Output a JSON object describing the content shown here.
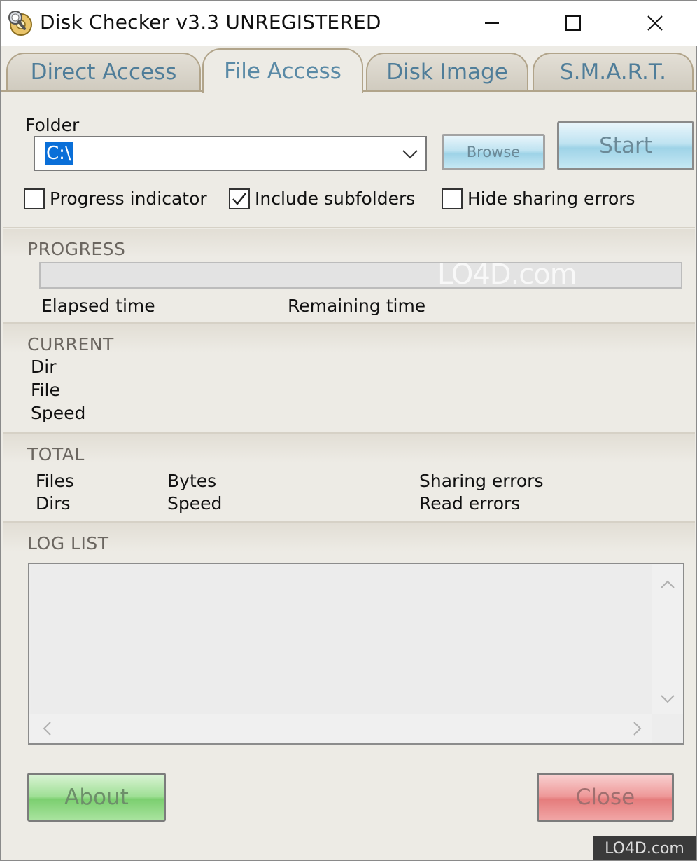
{
  "window": {
    "title": "Disk Checker v3.3 UNREGISTERED",
    "minimize_icon": "minimize-icon",
    "maximize_icon": "maximize-icon",
    "close_icon": "close-icon"
  },
  "tabs": [
    {
      "label": "Direct Access",
      "active": false
    },
    {
      "label": "File Access",
      "active": true
    },
    {
      "label": "Disk Image",
      "active": false
    },
    {
      "label": "S.M.A.R.T.",
      "active": false
    }
  ],
  "folder": {
    "label": "Folder",
    "value": "C:\\",
    "browse_label": "Browse",
    "start_label": "Start"
  },
  "options": {
    "progress_indicator": {
      "label": "Progress indicator",
      "checked": false
    },
    "include_subfolders": {
      "label": "Include subfolders",
      "checked": true
    },
    "hide_sharing_errors": {
      "label": "Hide sharing errors",
      "checked": false
    }
  },
  "progress": {
    "title": "PROGRESS",
    "fraction": 0,
    "elapsed_label": "Elapsed time",
    "remaining_label": "Remaining time"
  },
  "current": {
    "title": "CURRENT",
    "dir_label": "Dir",
    "file_label": "File",
    "speed_label": "Speed"
  },
  "total": {
    "title": "TOTAL",
    "files_label": "Files",
    "dirs_label": "Dirs",
    "bytes_label": "Bytes",
    "speed_label": "Speed",
    "sharing_errors_label": "Sharing errors",
    "read_errors_label": "Read errors"
  },
  "log": {
    "title": "LOG LIST"
  },
  "buttons": {
    "about_label": "About",
    "close_label": "Close"
  },
  "watermark": {
    "text": "LO4D.com"
  },
  "colors": {
    "tab_text": "#4f7d99",
    "selection": "#0a6fd8",
    "about_green": "#7ccf70",
    "close_red": "#e57c7c"
  }
}
